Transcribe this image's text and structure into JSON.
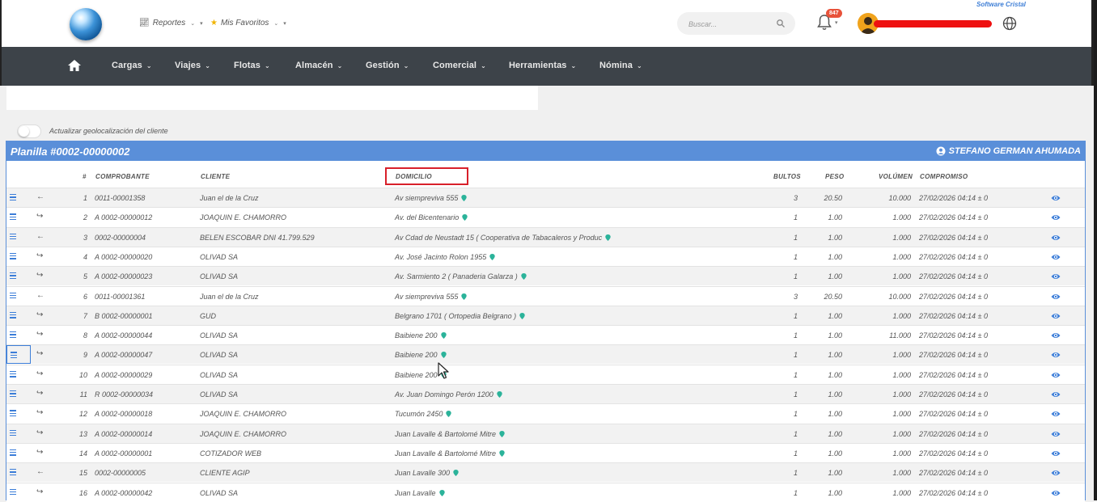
{
  "brand": "Software Cristal",
  "top_menu": [
    {
      "label": "Reportes",
      "icon": "chart-icon"
    },
    {
      "label": "Mis Favoritos",
      "icon": "star-icon"
    }
  ],
  "search": {
    "placeholder": "Buscar..."
  },
  "notifications": {
    "count": "847"
  },
  "nav": {
    "items": [
      "Cargas",
      "Viajes",
      "Flotas",
      "Almacén",
      "Gestión",
      "Comercial",
      "Herramientas",
      "Nómina"
    ]
  },
  "toggle_label": "Actualizar geolocalización del cliente",
  "planilla": {
    "title": "Planilla #0002-00000002",
    "user": "STEFANO GERMAN AHUMADA"
  },
  "columns": {
    "num": "#",
    "comprobante": "COMPROBANTE",
    "cliente": "CLIENTE",
    "domicilio": "DOMICILIO",
    "bultos": "BULTOS",
    "peso": "PESO",
    "volumen": "VOLÚMEN",
    "compromiso": "COMPROMISO"
  },
  "rows": [
    {
      "dir": "←",
      "num": "1",
      "comprobante": "0011-00001358",
      "cliente": "Juan el de la Cruz",
      "domicilio": "Av siempreviva 555",
      "bultos": "3",
      "peso": "20.50",
      "volumen": "10.000",
      "compromiso": "27/02/2026 04:14 ± 0"
    },
    {
      "dir": "↪",
      "num": "2",
      "comprobante": "A 0002-00000012",
      "cliente": "JOAQUIN E. CHAMORRO",
      "domicilio": "Av. del Bicentenario",
      "bultos": "1",
      "peso": "1.00",
      "volumen": "1.000",
      "compromiso": "27/02/2026 04:14 ± 0"
    },
    {
      "dir": "←",
      "num": "3",
      "comprobante": "0002-00000004",
      "cliente": "BELEN ESCOBAR DNI 41.799.529",
      "domicilio": "Av Cdad de Neustadt 15 ( Cooperativa de Tabacaleros y Produc",
      "bultos": "1",
      "peso": "1.00",
      "volumen": "1.000",
      "compromiso": "27/02/2026 04:14 ± 0"
    },
    {
      "dir": "↪",
      "num": "4",
      "comprobante": "A 0002-00000020",
      "cliente": "OLIVAD SA",
      "domicilio": "Av. José Jacinto Rolon 1955",
      "bultos": "1",
      "peso": "1.00",
      "volumen": "1.000",
      "compromiso": "27/02/2026 04:14 ± 0"
    },
    {
      "dir": "↪",
      "num": "5",
      "comprobante": "A 0002-00000023",
      "cliente": "OLIVAD SA",
      "domicilio": "Av. Sarmiento 2 ( Panaderia Galarza )",
      "bultos": "1",
      "peso": "1.00",
      "volumen": "1.000",
      "compromiso": "27/02/2026 04:14 ± 0"
    },
    {
      "dir": "←",
      "num": "6",
      "comprobante": "0011-00001361",
      "cliente": "Juan el de la Cruz",
      "domicilio": "Av siempreviva 555",
      "bultos": "3",
      "peso": "20.50",
      "volumen": "10.000",
      "compromiso": "27/02/2026 04:14 ± 0"
    },
    {
      "dir": "↪",
      "num": "7",
      "comprobante": "B 0002-00000001",
      "cliente": "GUD",
      "domicilio": "Belgrano 1701 ( Ortopedia Belgrano )",
      "bultos": "1",
      "peso": "1.00",
      "volumen": "1.000",
      "compromiso": "27/02/2026 04:14 ± 0"
    },
    {
      "dir": "↪",
      "num": "8",
      "comprobante": "A 0002-00000044",
      "cliente": "OLIVAD SA",
      "domicilio": "Baibiene 200",
      "bultos": "1",
      "peso": "1.00",
      "volumen": "11.000",
      "compromiso": "27/02/2026 04:14 ± 0"
    },
    {
      "dir": "↪",
      "num": "9",
      "comprobante": "A 0002-00000047",
      "cliente": "OLIVAD SA",
      "domicilio": "Baibiene 200",
      "bultos": "1",
      "peso": "1.00",
      "volumen": "1.000",
      "compromiso": "27/02/2026 04:14 ± 0"
    },
    {
      "dir": "↪",
      "num": "10",
      "comprobante": "A 0002-00000029",
      "cliente": "OLIVAD SA",
      "domicilio": "Baibiene 200",
      "bultos": "1",
      "peso": "1.00",
      "volumen": "1.000",
      "compromiso": "27/02/2026 04:14 ± 0"
    },
    {
      "dir": "↪",
      "num": "11",
      "comprobante": "R 0002-00000034",
      "cliente": "OLIVAD SA",
      "domicilio": "Av. Juan Domingo Perón 1200",
      "bultos": "1",
      "peso": "1.00",
      "volumen": "1.000",
      "compromiso": "27/02/2026 04:14 ± 0"
    },
    {
      "dir": "↪",
      "num": "12",
      "comprobante": "A 0002-00000018",
      "cliente": "JOAQUIN E. CHAMORRO",
      "domicilio": "Tucumón 2450",
      "bultos": "1",
      "peso": "1.00",
      "volumen": "1.000",
      "compromiso": "27/02/2026 04:14 ± 0"
    },
    {
      "dir": "↪",
      "num": "13",
      "comprobante": "A 0002-00000014",
      "cliente": "JOAQUIN E. CHAMORRO",
      "domicilio": "Juan Lavalle & Bartolomé Mitre",
      "bultos": "1",
      "peso": "1.00",
      "volumen": "1.000",
      "compromiso": "27/02/2026 04:14 ± 0"
    },
    {
      "dir": "↪",
      "num": "14",
      "comprobante": "A 0002-00000001",
      "cliente": "COTIZADOR WEB",
      "domicilio": "Juan Lavalle & Bartolomé Mitre",
      "bultos": "1",
      "peso": "1.00",
      "volumen": "1.000",
      "compromiso": "27/02/2026 04:14 ± 0"
    },
    {
      "dir": "←",
      "num": "15",
      "comprobante": "0002-00000005",
      "cliente": "CLIENTE AGIP",
      "domicilio": "Juan Lavalle 300",
      "bultos": "1",
      "peso": "1.00",
      "volumen": "1.000",
      "compromiso": "27/02/2026 04:14 ± 0"
    },
    {
      "dir": "↪",
      "num": "16",
      "comprobante": "A 0002-00000042",
      "cliente": "OLIVAD SA",
      "domicilio": "Juan Lavalle",
      "bultos": "1",
      "peso": "1.00",
      "volumen": "1.000",
      "compromiso": "27/02/2026 04:14 ± 0"
    }
  ],
  "colors": {
    "accent": "#5a8fd9",
    "nav_bg": "#3d4349",
    "pin": "#2bb39a",
    "highlight": "#d8202a",
    "badge": "#e8523a"
  }
}
